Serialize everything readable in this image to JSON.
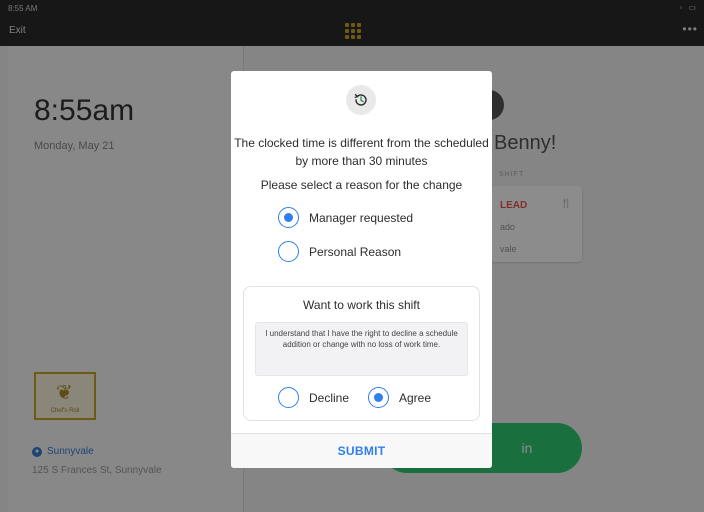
{
  "status": {
    "time": "8:55 AM"
  },
  "topbar": {
    "exit_label": "Exit",
    "more_label": "•••"
  },
  "left": {
    "clock": "8:55am",
    "date": "Monday, May 21",
    "logo_text": "Chef's Roll",
    "location": "Sunnyvale",
    "address": "125 S Frances St, Sunnyvale"
  },
  "right": {
    "greeting": "Benny!",
    "shift_label": "SHIFT",
    "shift_role": "LEAD",
    "shift_line1": "ado",
    "shift_line2": "vale",
    "clockin_label": "in"
  },
  "modal": {
    "message": "The clocked time is different from the scheduled by more than 30 minutes",
    "prompt": "Please select a reason for the change",
    "reasons": [
      {
        "label": "Manager requested",
        "selected": true
      },
      {
        "label": "Personal Reason",
        "selected": false
      }
    ],
    "work_title": "Want to work this shift",
    "notice": "I understand that I have the right to decline a schedule addition or change with no loss of work time.",
    "decline_label": "Decline",
    "agree_label": "Agree",
    "agree_selected": true,
    "submit_label": "SUBMIT"
  },
  "colors": {
    "accent": "#2f80ed",
    "overlay": "#000000",
    "clockin": "#2ecc71",
    "alert": "#e55a4e"
  }
}
